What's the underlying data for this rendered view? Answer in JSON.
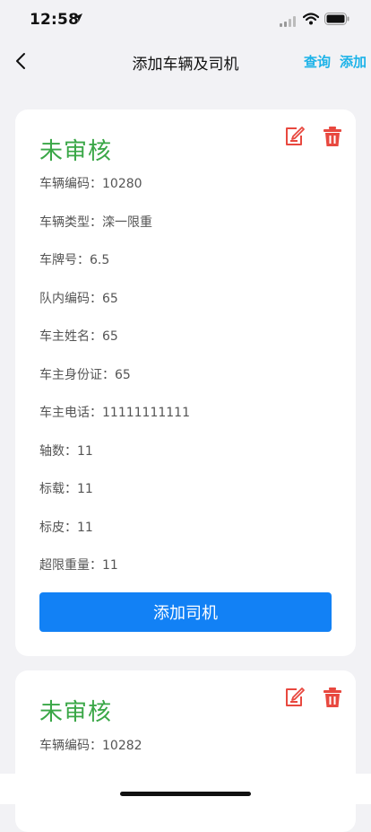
{
  "status_bar": {
    "time": "12:58"
  },
  "nav": {
    "title": "添加车辆及司机",
    "query_label": "查询",
    "add_label": "添加"
  },
  "vehicles": [
    {
      "status": "未审核",
      "fields": [
        {
          "label": "车辆编码：",
          "value": "10280"
        },
        {
          "label": "车辆类型：",
          "value": "滦一限重"
        },
        {
          "label": "车牌号：",
          "value": "6.5"
        },
        {
          "label": "队内编码：",
          "value": "65"
        },
        {
          "label": "车主姓名：",
          "value": "65"
        },
        {
          "label": "车主身份证：",
          "value": "65"
        },
        {
          "label": "车主电话：",
          "value": "11111111111"
        },
        {
          "label": "轴数：",
          "value": "11"
        },
        {
          "label": "标载：",
          "value": "11"
        },
        {
          "label": "标皮：",
          "value": "11"
        },
        {
          "label": "超限重量：",
          "value": "11"
        }
      ],
      "add_driver_label": "添加司机"
    },
    {
      "status": "未审核",
      "fields": [
        {
          "label": "车辆编码：",
          "value": "10282"
        }
      ]
    }
  ],
  "colors": {
    "status_pending": "#3aa747",
    "action_icon": "#e8483f",
    "primary_button": "#1281f5",
    "nav_action": "#1eb3e8"
  }
}
